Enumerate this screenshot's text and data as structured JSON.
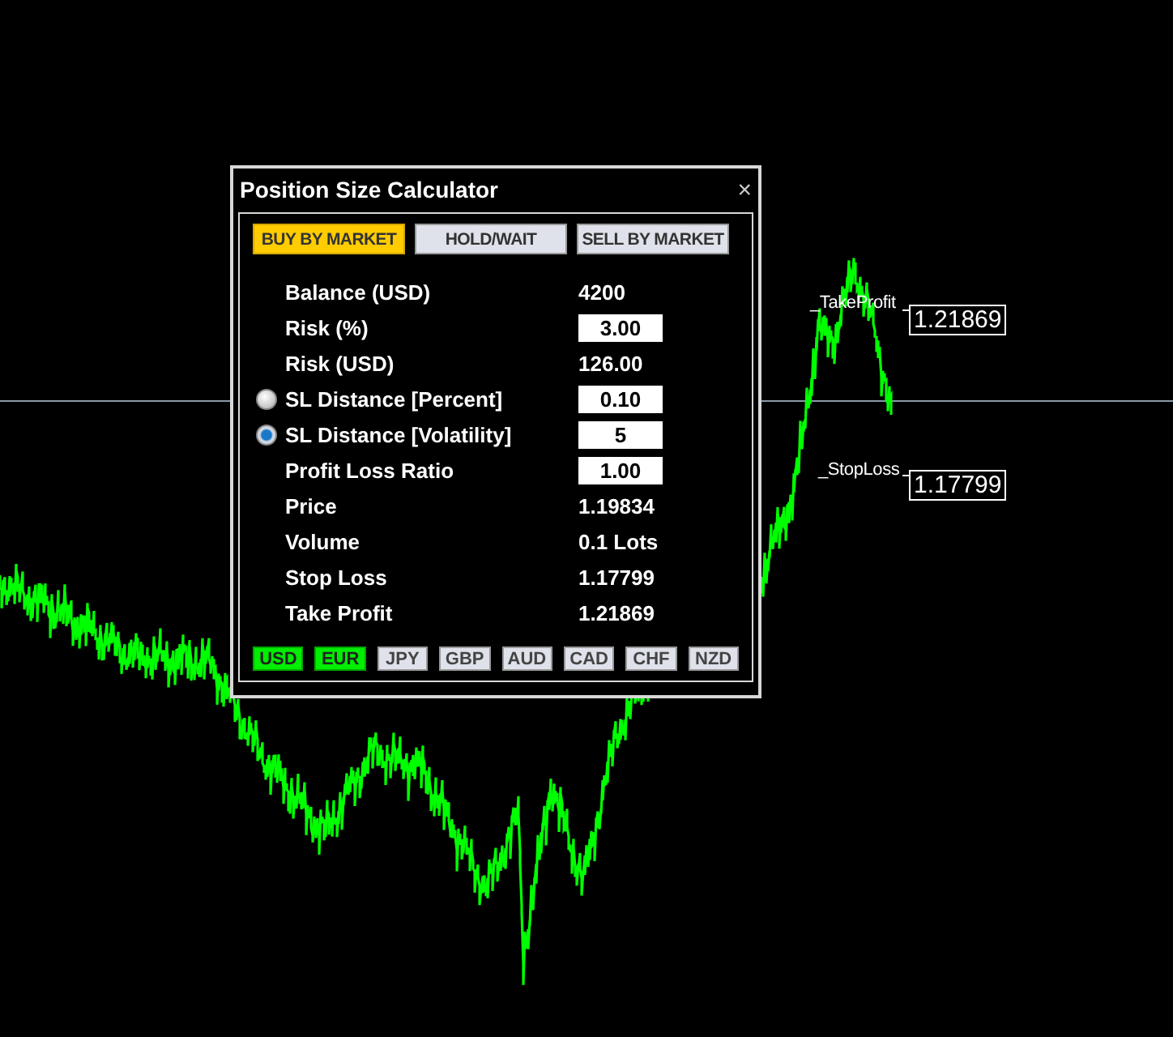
{
  "window": {
    "title": "Position Size Calculator",
    "close": "×"
  },
  "actions": [
    {
      "label": "BUY BY MARKET",
      "selected": true
    },
    {
      "label": "HOLD/WAIT",
      "selected": false
    },
    {
      "label": "SELL BY MARKET",
      "selected": false
    }
  ],
  "rows": [
    {
      "kind": "value",
      "label": "Balance (USD)",
      "value": "4200"
    },
    {
      "kind": "input",
      "label": "Risk (%)",
      "value": "3.00"
    },
    {
      "kind": "value",
      "label": "Risk (USD)",
      "value": "126.00"
    },
    {
      "kind": "radio",
      "label": "SL Distance [Percent]",
      "value": "0.10",
      "selected": false
    },
    {
      "kind": "radio",
      "label": "SL Distance [Volatility]",
      "value": "5",
      "selected": true
    },
    {
      "kind": "input",
      "label": "Profit Loss Ratio",
      "value": "1.00"
    },
    {
      "kind": "value",
      "label": "Price",
      "value": "1.19834"
    },
    {
      "kind": "value",
      "label": "Volume",
      "value": "0.1 Lots"
    },
    {
      "kind": "value",
      "label": "Stop Loss",
      "value": "1.17799"
    },
    {
      "kind": "value",
      "label": "Take Profit",
      "value": "1.21869"
    }
  ],
  "currencies": [
    {
      "label": "USD",
      "selected": true
    },
    {
      "label": "EUR",
      "selected": true
    },
    {
      "label": "JPY",
      "selected": false
    },
    {
      "label": "GBP",
      "selected": false
    },
    {
      "label": "AUD",
      "selected": false
    },
    {
      "label": "CAD",
      "selected": false
    },
    {
      "label": "CHF",
      "selected": false
    },
    {
      "label": "NZD",
      "selected": false
    }
  ],
  "chart_lines": [
    {
      "label": "_TakeProfit",
      "price": "1.21869"
    },
    {
      "label": "_StopLoss",
      "price": "1.17799"
    }
  ]
}
